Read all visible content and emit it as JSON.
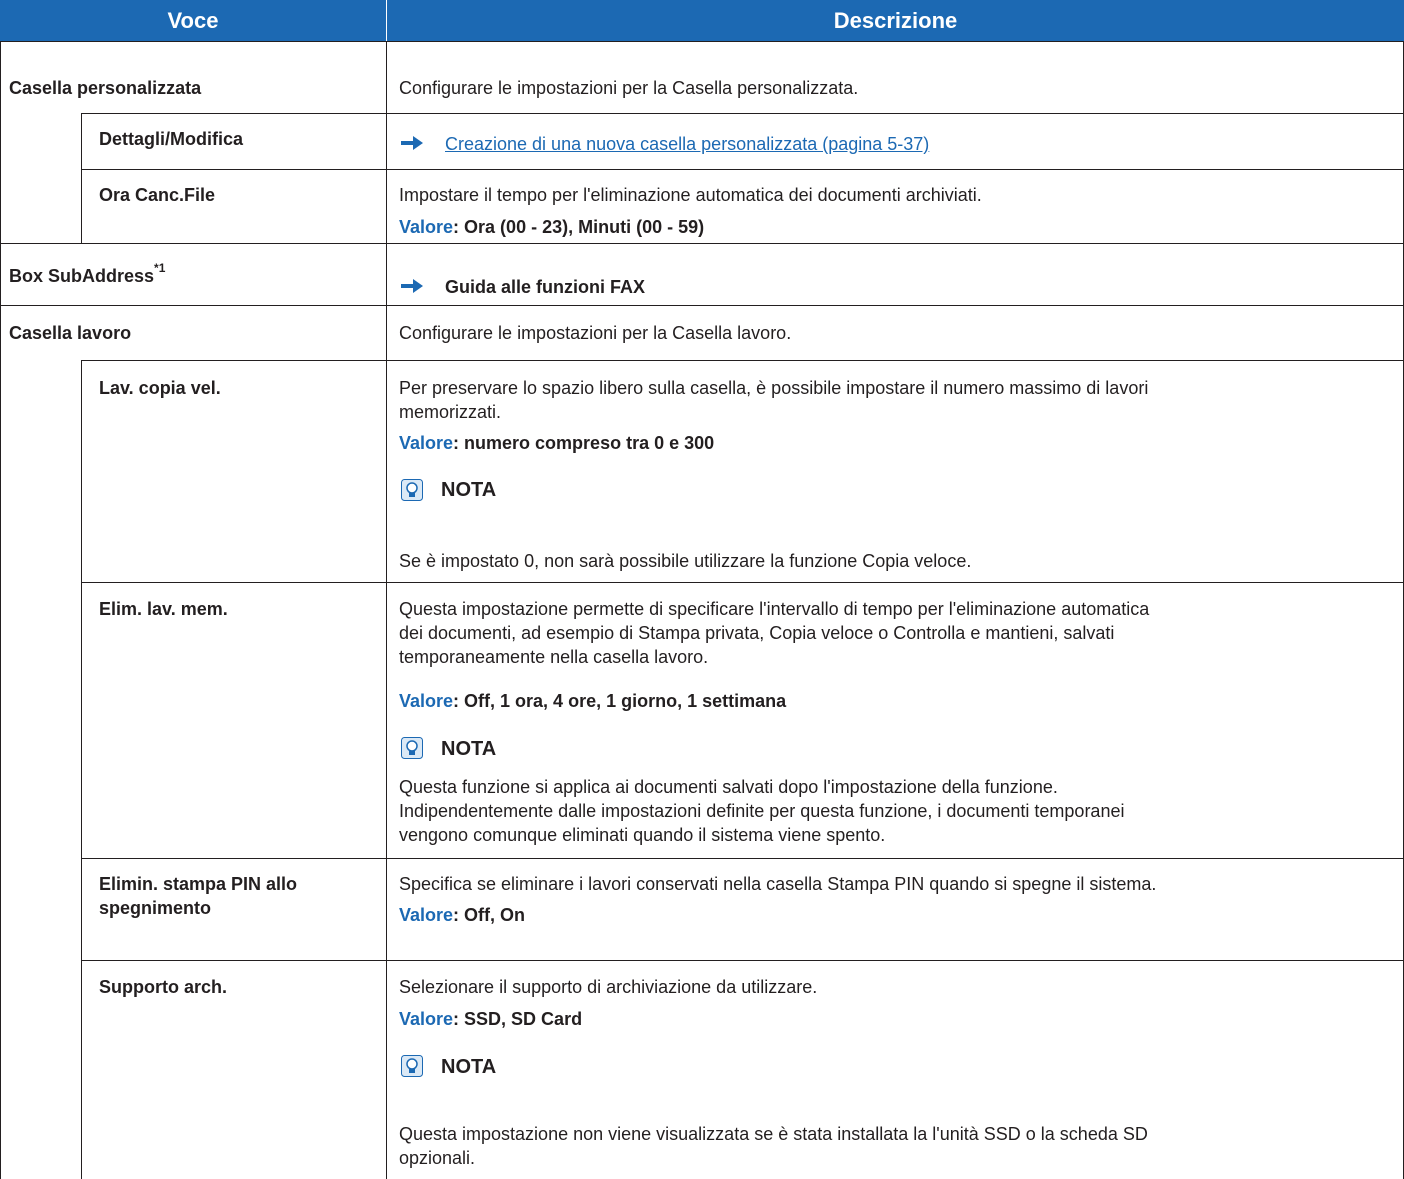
{
  "table": {
    "headers": {
      "item": "Voce",
      "description": "Descrizione"
    },
    "value_label": "Valore",
    "note_label": "NOTA",
    "rows": {
      "casella_personalizzata": {
        "label": "Casella personalizzata",
        "desc": "Configurare le impostazioni per la Casella personalizzata."
      },
      "dettagli": {
        "label": "Dettagli/Modifica",
        "link": "Creazione di una nuova casella personalizzata (pagina 5-37)"
      },
      "ora_canc": {
        "label": "Ora Canc.File",
        "desc": "Impostare il tempo per l'eliminazione automatica dei documenti archiviati.",
        "value": ": Ora (00 - 23), Minuti (00 - 59)"
      },
      "box_subaddress": {
        "label": "Box SubAddress",
        "footnote": "*1",
        "ref": "Guida alle funzioni FAX"
      },
      "casella_lavoro": {
        "label": "Casella lavoro",
        "desc": "Configurare le impostazioni per la Casella lavoro."
      },
      "lav_copia": {
        "label": "Lav. copia vel.",
        "desc_lines": [
          "Per preservare lo spazio libero sulla casella, è possibile impostare il numero massimo di lavori",
          "memorizzati."
        ],
        "value": ": numero compreso tra 0 e 300",
        "note": "Se è impostato 0, non sarà possibile utilizzare la funzione Copia veloce."
      },
      "elim_lav": {
        "label": "Elim. lav. mem.",
        "desc_lines": [
          "Questa impostazione permette di specificare l'intervallo di tempo per l'eliminazione automatica",
          "dei documenti, ad esempio di Stampa privata, Copia veloce o Controlla e mantieni, salvati",
          "temporaneamente nella casella lavoro."
        ],
        "value": ": Off, 1 ora, 4 ore, 1 giorno, 1 settimana",
        "note_lines": [
          "Questa funzione si applica ai documenti salvati dopo l'impostazione della funzione.",
          "Indipendentemente dalle impostazioni definite per questa funzione, i documenti temporanei",
          "vengono comunque eliminati quando il sistema viene spento."
        ]
      },
      "elimin_pin": {
        "label_lines": [
          "Elimin. stampa PIN allo",
          "spegnimento"
        ],
        "desc": "Specifica se eliminare i lavori conservati nella casella Stampa PIN quando si spegne il sistema.",
        "value": ": Off, On"
      },
      "supporto": {
        "label": "Supporto arch.",
        "desc": "Selezionare il supporto di archiviazione da utilizzare.",
        "value": ": SSD, SD Card",
        "note_lines": [
          "Questa impostazione non viene visualizzata se è stata installata la l'unità SSD o la scheda SD",
          "opzionali."
        ]
      }
    }
  },
  "colors": {
    "header_bg": "#1c69b3",
    "accent": "#1c69b3",
    "text": "#231f20"
  },
  "icons": {
    "arrow": "arrow-right-icon",
    "note": "lightbulb-icon"
  }
}
